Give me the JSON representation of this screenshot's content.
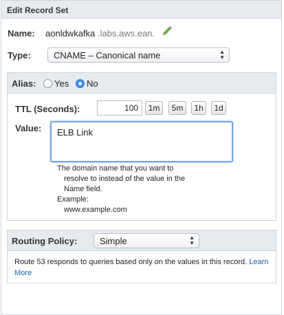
{
  "panel": {
    "title": "Edit Record Set"
  },
  "name": {
    "label": "Name:",
    "value": "aonldwkafka",
    "suffix": ".labs.aws.ean."
  },
  "type": {
    "label": "Type:",
    "selected": "CNAME – Canonical name"
  },
  "alias": {
    "label": "Alias:",
    "options": [
      "Yes",
      "No"
    ],
    "selected": "No"
  },
  "ttl": {
    "label": "TTL (Seconds):",
    "value": "100",
    "buttons": [
      "1m",
      "5m",
      "1h",
      "1d"
    ]
  },
  "value_field": {
    "label": "Value:",
    "value": "ELB Link",
    "help_line1": "The domain name that you want to",
    "help_line2": "resolve to instead of the value in the",
    "help_line3": "Name field.",
    "example_label": "Example:",
    "example_value": "www.example.com"
  },
  "routing": {
    "label": "Routing Policy:",
    "selected": "Simple",
    "description": "Route 53 responds to queries based only on the values in this record.",
    "learn_more": "Learn More"
  },
  "icons": {
    "edit": "pencil-icon"
  },
  "colors": {
    "header_bg": "#e6ebf0",
    "accent": "#3b8df1",
    "link": "#1a5fb4"
  }
}
